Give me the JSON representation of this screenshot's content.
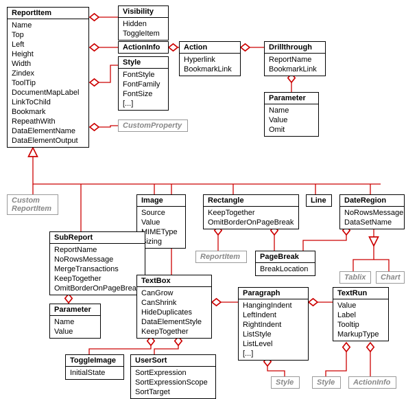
{
  "boxes": {
    "reportItem": {
      "title": "ReportItem",
      "props": [
        "Name",
        "Top",
        "Left",
        "Height",
        "Width",
        "Zindex",
        "ToolTip",
        "DocumentMapLabel",
        "LinkToChild",
        "Bookmark",
        "RepeathWith",
        "DataElementName",
        "DataElementOutput"
      ]
    },
    "visibility": {
      "title": "Visibility",
      "props": [
        "Hidden",
        "ToggleItem"
      ]
    },
    "actionInfo": {
      "title": "ActionInfo"
    },
    "style": {
      "title": "Style",
      "props": [
        "FontStyle",
        "FontFamily",
        "FontSize",
        "[...]"
      ]
    },
    "customProperty": {
      "title": "CustomProperty"
    },
    "action": {
      "title": "Action",
      "props": [
        "Hyperlink",
        "BookmarkLink"
      ]
    },
    "drillthrough": {
      "title": "Drillthrough",
      "props": [
        "ReportName",
        "BookmarkLink"
      ]
    },
    "parameter": {
      "title": "Parameter",
      "props": [
        "Name",
        "Value",
        "Omit"
      ]
    },
    "customReportItem": {
      "title": "Custom\nReportItem"
    },
    "image": {
      "title": "Image",
      "props": [
        "Source",
        "Value",
        "MIMEType",
        "Sizing"
      ]
    },
    "rectangle": {
      "title": "Rectangle",
      "props": [
        "KeepTogether",
        "OmitBorderOnPageBreak"
      ]
    },
    "line": {
      "title": "Line"
    },
    "dateRegion": {
      "title": "DateRegion",
      "props": [
        "NoRowsMessage",
        "DataSetName"
      ]
    },
    "reportItemRef": {
      "title": "ReportItem"
    },
    "pageBreak": {
      "title": "PageBreak",
      "props": [
        "BreakLocation"
      ]
    },
    "tablix": {
      "title": "Tablix"
    },
    "chart": {
      "title": "Chart"
    },
    "subReport": {
      "title": "SubReport",
      "props": [
        "ReportName",
        "NoRowsMessage",
        "MergeTransactions",
        "KeepTogether",
        "OmitBorderOnPageBreak"
      ]
    },
    "parameter2": {
      "title": "Parameter",
      "props": [
        "Name",
        "Value"
      ]
    },
    "textBox": {
      "title": "TextBox",
      "props": [
        "CanGrow",
        "CanShrink",
        "HideDuplicates",
        "DataElementStyle",
        "KeepTogether"
      ]
    },
    "paragraph": {
      "title": "Paragraph",
      "props": [
        "HangingIndent",
        "LeftIndent",
        "RightIndent",
        "ListStyle",
        "ListLevel",
        "[...]"
      ]
    },
    "textRun": {
      "title": "TextRun",
      "props": [
        "Value",
        "Label",
        "Tooltip",
        "MarkupType"
      ]
    },
    "toggleImage": {
      "title": "ToggleImage",
      "props": [
        "InitialState"
      ]
    },
    "userSort": {
      "title": "UserSort",
      "props": [
        "SortExpression",
        "SortExpressionScope",
        "SortTarget"
      ]
    },
    "styleRef1": {
      "title": "Style"
    },
    "styleRef2": {
      "title": "Style"
    },
    "actionInfoRef": {
      "title": "ActionInfo"
    }
  }
}
